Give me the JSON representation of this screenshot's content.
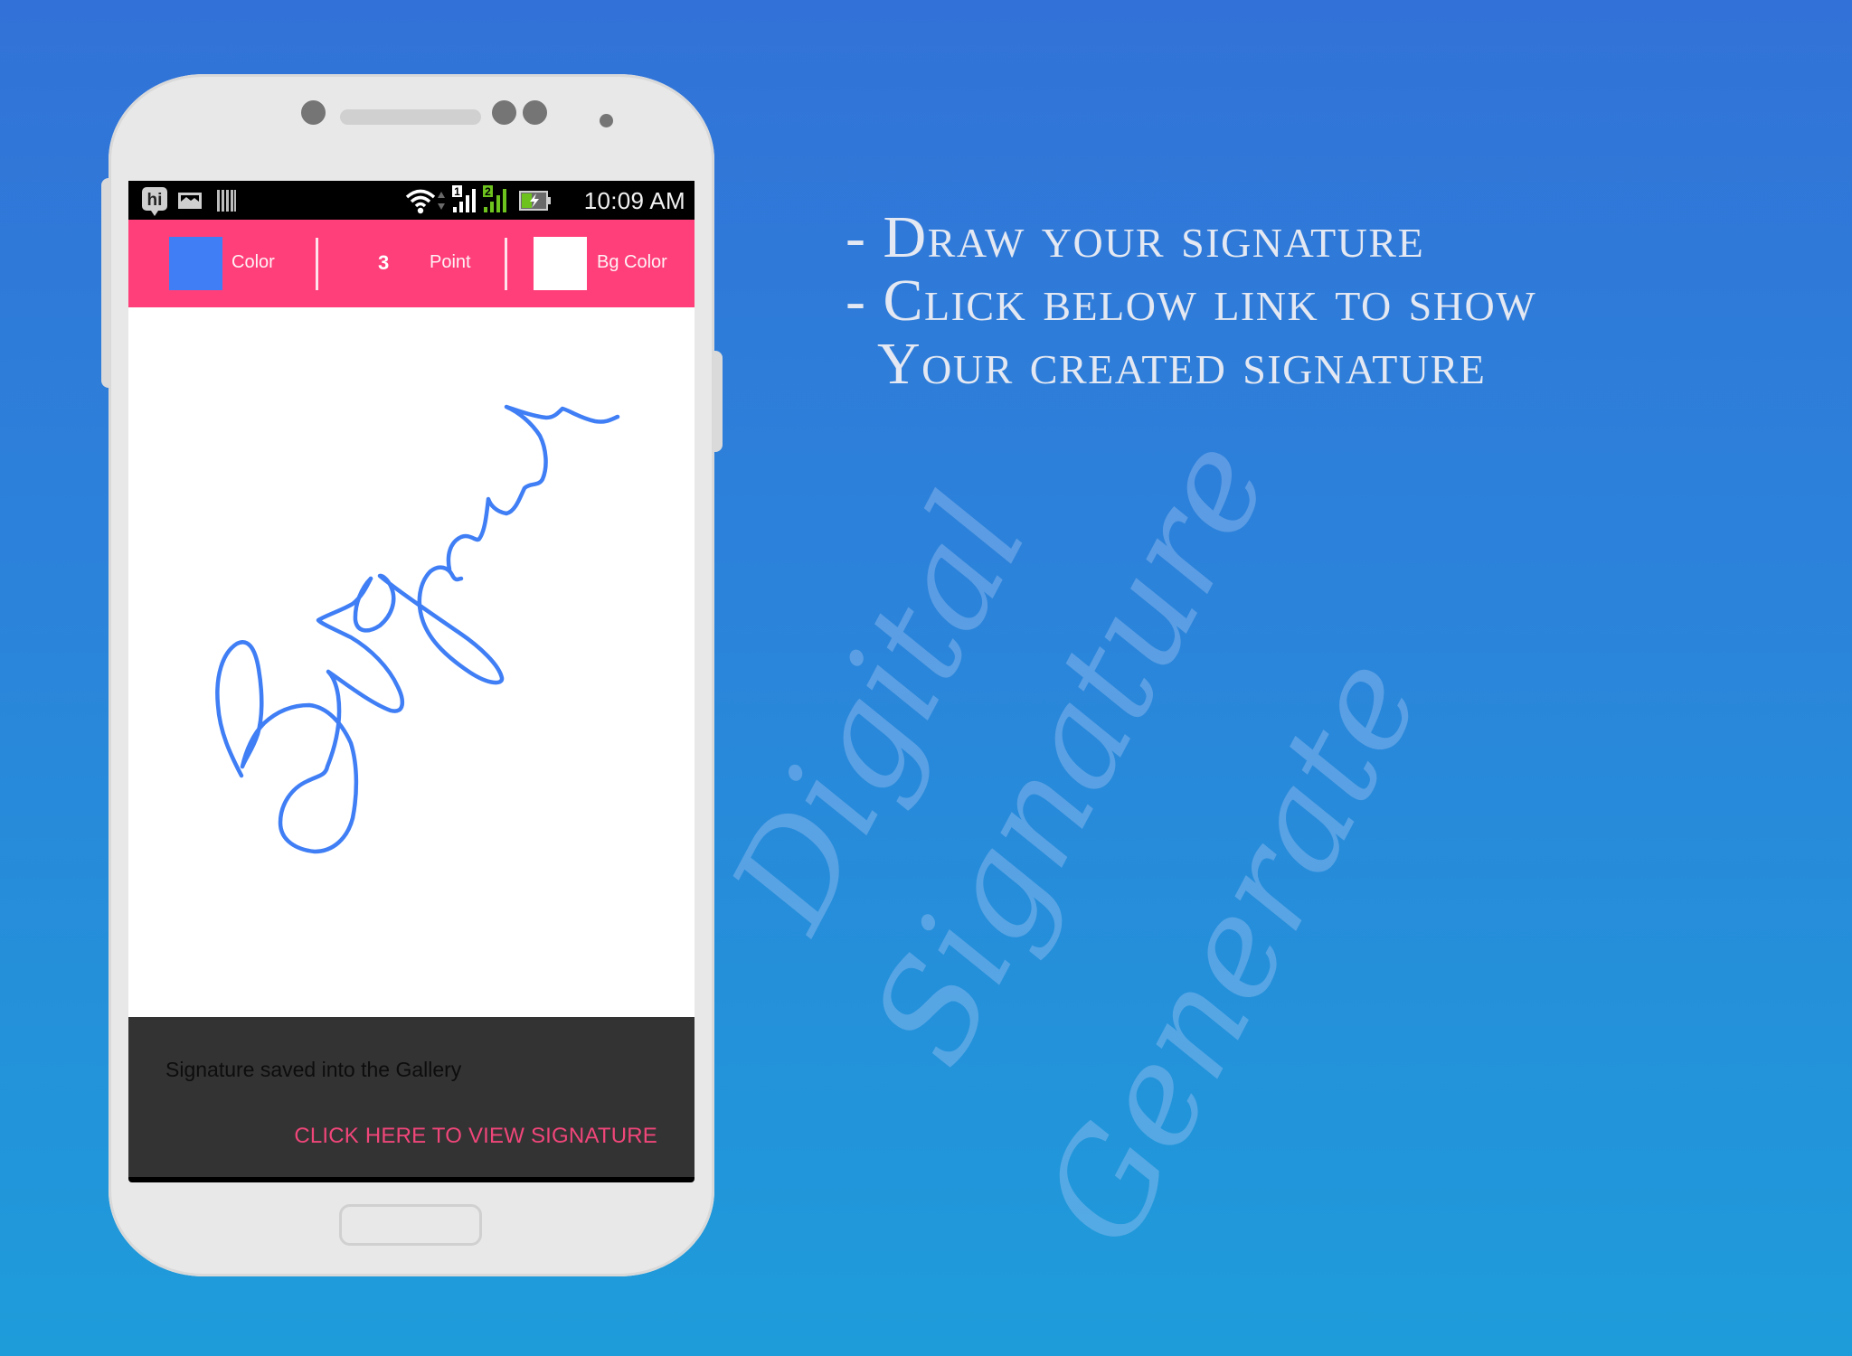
{
  "background": {
    "gradient_top": "#3272D8",
    "gradient_bottom": "#1E9CDA"
  },
  "status_bar": {
    "left_icons": [
      "hike-messenger-icon",
      "gallery-icon",
      "barcode-icon"
    ],
    "right_icons": [
      "wifi-icon",
      "data-arrows-icon",
      "signal-sim1-icon",
      "signal-sim2-icon",
      "battery-charging-icon"
    ],
    "sim1_label": "1",
    "sim2_label": "2",
    "time": "10:09 AM"
  },
  "toolbar": {
    "pen_color": "#3F7EF5",
    "color_label": "Color",
    "point_value": "3",
    "point_label": "Point",
    "bg_color": "#FFFFFF",
    "bg_color_label": "Bg Color",
    "bar_color": "#FF3F7A"
  },
  "canvas": {
    "stroke_color": "#3F7EF5",
    "stroke_width": "3",
    "content": "handwritten signature"
  },
  "snackbar": {
    "message": "Signature saved into the Gallery",
    "action": "CLICK HERE TO VIEW SIGNATURE",
    "action_color": "#F0467A"
  },
  "feature_list": {
    "line1": "- Draw your signature",
    "line2": "- Click below link to show",
    "line3": "Your created signature"
  },
  "watermark": {
    "line1": "Digital",
    "line2": "Signature",
    "line3": "Generate"
  }
}
